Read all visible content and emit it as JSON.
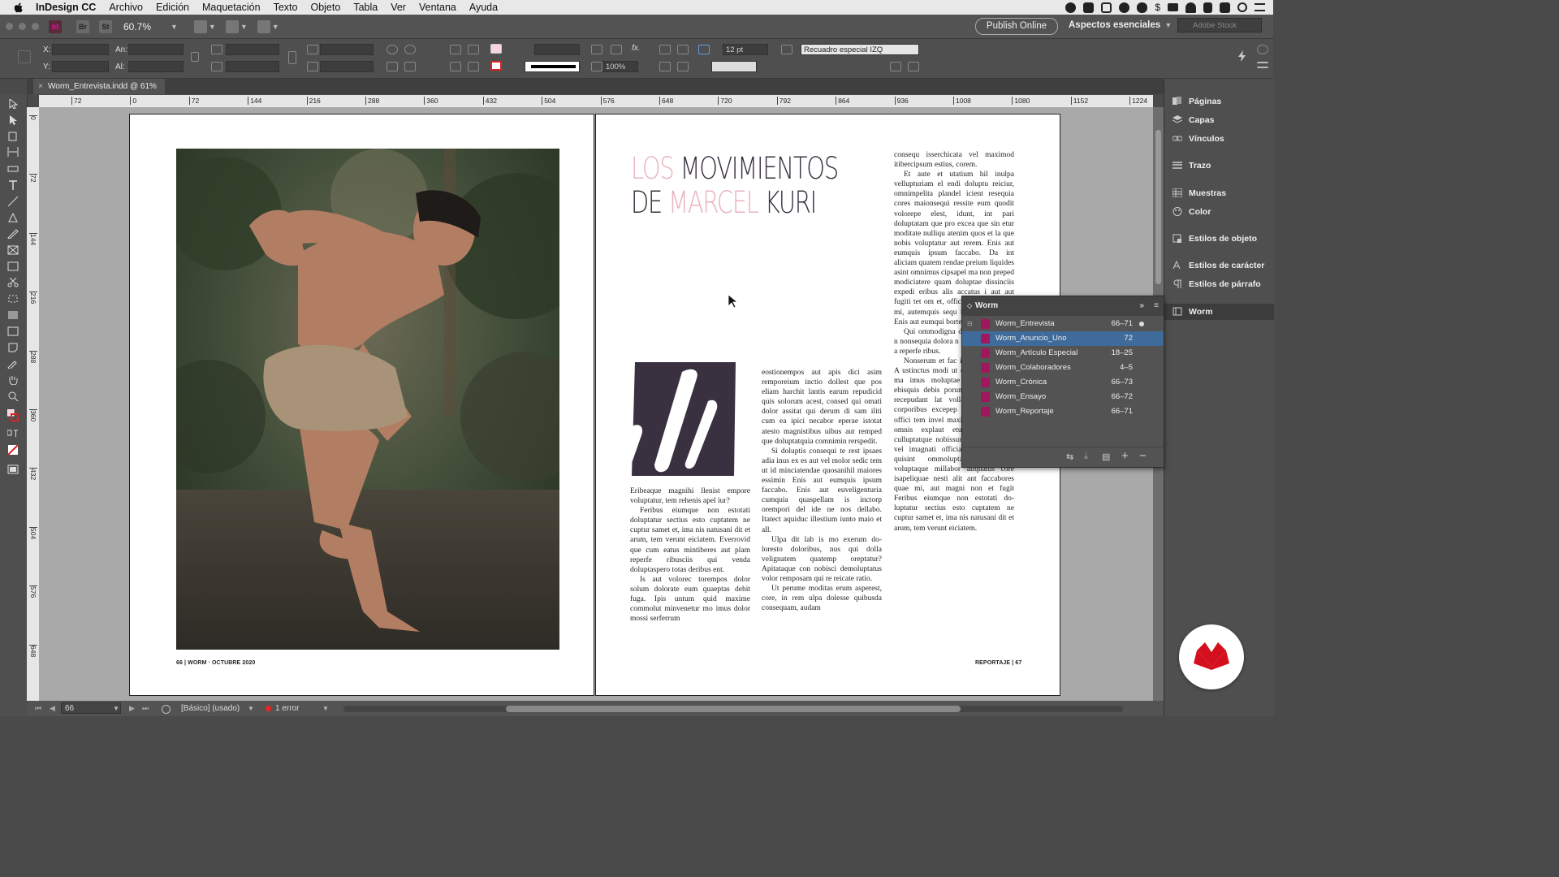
{
  "menubar": {
    "app_name": "InDesign CC",
    "items": [
      "Archivo",
      "Edición",
      "Maquetación",
      "Texto",
      "Objeto",
      "Tabla",
      "Ver",
      "Ventana",
      "Ayuda"
    ]
  },
  "appbar": {
    "br_label": "Br",
    "st_label": "St",
    "zoom": "60.7%",
    "publish_label": "Publish Online",
    "workspace_label": "Aspectos esenciales",
    "stock_placeholder": "Adobe Stock"
  },
  "control": {
    "x_label": "X:",
    "y_label": "Y:",
    "w_label": "An:",
    "h_label": "Al:",
    "stroke_weight": "12 pt",
    "object_style": "Recuadro especial IZQ",
    "scale": "100%"
  },
  "doc_tab": {
    "title": "Worm_Entrevista.indd @ 61%"
  },
  "rulers": {
    "h_ticks": [
      "72",
      "0",
      "72",
      "144",
      "216",
      "288",
      "360",
      "432",
      "504",
      "576",
      "648",
      "720",
      "792",
      "864",
      "936",
      "1008",
      "1080",
      "1152",
      "1224"
    ],
    "v_ticks": [
      "0",
      "72",
      "144",
      "216",
      "288",
      "360",
      "432",
      "504",
      "576",
      "648"
    ]
  },
  "spread": {
    "left_folio_num": "66",
    "left_folio": "| WORM · OCTUBRE 2020",
    "right_folio": "REPORTAJE |",
    "right_folio_num": "67",
    "headline_line1_a": "LOS",
    "headline_line1_b": " MOVIMIENTOS",
    "headline_line2_a": "DE ",
    "headline_line2_b": "MARCEL",
    "headline_line2_c": " KURI",
    "dropcap": "Z",
    "col1": [
      "Eribeaque magnihi llenist empore voluptatur, tem rehenis apel iur?",
      "Feribus eiumque non estotati doluptatur sectius esto cuptatem ne cuptur samet et, ima nis natu­sani dit et arum, tem verunt ei­ciatem. Everrovid que cum eatus mintiberes aut plam reperfe ri­busciis qui venda doluptaspero totas deribus ent.",
      "Is aut volorec torempos dolor solum dolorate eum quaeptas debit fuga. Ipis untum quid maxime commolut minvenetur mo imus dolor mossi serferrum"
    ],
    "col2": [
      "eostionempos aut apis dici asim remporeium inctio dollest que pos eliam harchit lantis earum repu­dicid quis solorum acest, consed qui omati dolor assitat qui derum di sam iliti cum ea ipici necabor eperae istotat atesto magnistibus uibus aut remped que doluptat­quia comnimin rerspedit.",
      "Si doluptis consequi te rest ipsaes adia inus ex es aut vel mo­lor sedic tem ut id minciatendae quosanihil maiores essimin Enis aut eumquis ipsum faccabo. Enis aut euveligenturia cumquia quas­pellam is inctorp orempori del ide ne nos dellabo. Itatect aquiduc illestium iunto maio et all.",
      "Ulpa dit lab is mo exerum do­loresto doloribus, nus qui dolla velignatem quatemp oreptatur? Apitataque con nobisci demolup­tatus volor remposam qui re rei­cate ratio.",
      "Ut perume moditas erum as­perest, core, in rem ulpa dolesse quibusda consequam, audam"
    ],
    "col3": [
      "consequ isserchicata vel maximod itibercipsum estius, corem.",
      "Et aute et utatium hil inulpa vellupturiam el endi doluptu rei­ciur, omnimpelita plandel icient resequia cores maionsequi ressite eum quodit volorepe elest, idunt, int pari doluptatam que pro excea que sin etur moditate nulliqu ate­nim quos et la que nobis volupta­tur aut rerem. Enis aut eumquis ipsum faccabo. Da int aliciam quatem rendae preium liquides asint omnimus cipsapel ma non preped modiciatere quam dolup­tae dissinciis expedi eribus alis accatus i aut aut fugiti tet om et, offic torest fugit quis mi, autemquis sequ idundem assit re Enis aut eumqui bortex opium delir",
      "Qui ommodigna deb isimolo blaut n nonsequia dolora n natur serspeles et a reperfe ribus.",
      "Nonserum et fac ipsam esequatur? A ustinctus modi ut o elluptias ilique ma imus moluptae prem nonsend ebisquis debis porum volor rem. Et recepudant lat volla estior ra ea corporibus excepер errorenim id ut offici tem invel maximporit hit, nust, omnis explaut etur, aut officiis culluptatque nobissunt eum aut volut vel imagnati offi­cias eniendunt od quisint ommo­luptatem reptatem voluptaque millabor aliquatus core isapeli­quae nesti alit ant faccabores quae mi, aut magni non et fugit Feribus eiumque non estotati do­luptatur sectius esto cuptatem ne cuptur samet et, ima nis natusani dit et arum, tem verunt eiciatem."
    ]
  },
  "right_panel": {
    "items": [
      "Páginas",
      "Capas",
      "Vínculos",
      "Trazo",
      "Muestras",
      "Color",
      "Estilos de objeto",
      "Estilos de carácter",
      "Estilos de párrafo",
      "Worm"
    ]
  },
  "book_panel": {
    "title": "Worm",
    "rows": [
      {
        "name": "Worm_Entrevista",
        "pages": "66–71"
      },
      {
        "name": "Worm_Anuncio_Uno",
        "pages": "72"
      },
      {
        "name": "Worm_Artículo Especial",
        "pages": "18–25"
      },
      {
        "name": "Worm_Colaboradores",
        "pages": "4–5"
      },
      {
        "name": "Worm_Crónica",
        "pages": "66–73"
      },
      {
        "name": "Worm_Ensayo",
        "pages": "66–72"
      },
      {
        "name": "Worm_Reportaje",
        "pages": "66–71"
      }
    ]
  },
  "status": {
    "page": "66",
    "profile": "[Básico] (usado)",
    "errors": "1 error"
  },
  "colors": {
    "accent_pink": "#e8b3bc",
    "dropcap_dark": "#3a3140",
    "book_doc_icon": "#a1175d",
    "selection": "#3e6b9a",
    "logo_red": "#d4101e"
  }
}
